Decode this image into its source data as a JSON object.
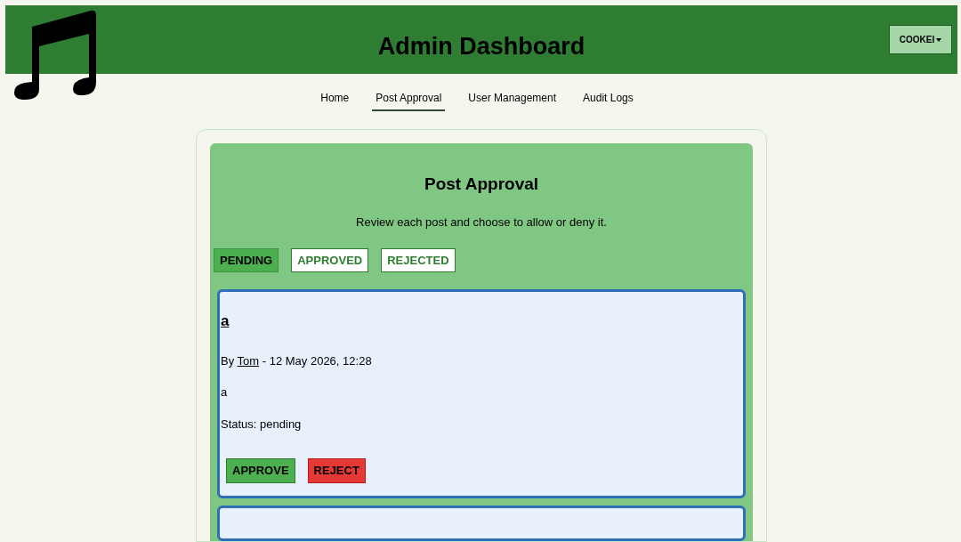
{
  "header": {
    "title": "Admin Dashboard",
    "user_menu": "COOKEI"
  },
  "nav": [
    {
      "label": "Home",
      "selected": false
    },
    {
      "label": "Post Approval",
      "selected": true
    },
    {
      "label": "User Management",
      "selected": false
    },
    {
      "label": "Audit Logs",
      "selected": false
    }
  ],
  "panel": {
    "title": "Post Approval",
    "subtitle": "Review each post and choose to allow or deny it."
  },
  "filters": [
    {
      "label": "PENDING",
      "selected": true
    },
    {
      "label": "APPROVED",
      "selected": false
    },
    {
      "label": "REJECTED",
      "selected": false
    }
  ],
  "posts": [
    {
      "title": "a",
      "by": "By",
      "author": "Tom",
      "date": "- 12 May 2026, 12:28",
      "body": "a",
      "status": "Status: pending",
      "actions": [
        {
          "label": "APPROVE",
          "kind": "approve"
        },
        {
          "label": "REJECT",
          "kind": "reject"
        }
      ]
    }
  ]
}
